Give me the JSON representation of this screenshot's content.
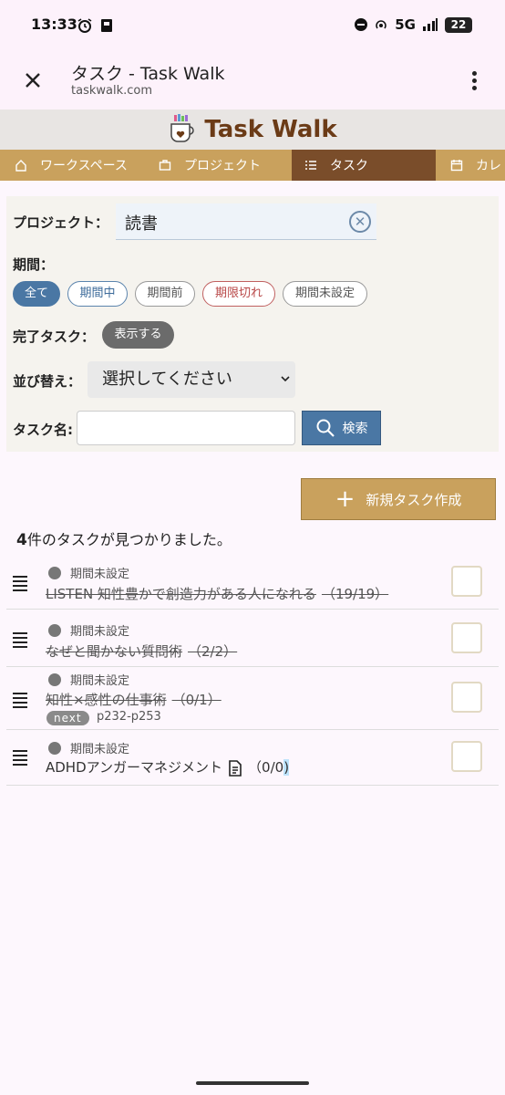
{
  "status": {
    "time": "13:33",
    "network": "5G",
    "battery": "22"
  },
  "browser": {
    "title": "タスク - Task Walk",
    "url": "taskwalk.com"
  },
  "site": {
    "brand": "Task Walk"
  },
  "nav": {
    "items": [
      {
        "label": "ワークスペース",
        "icon": "home-icon"
      },
      {
        "label": "プロジェクト",
        "icon": "briefcase-icon"
      },
      {
        "label": "タスク",
        "icon": "list-icon"
      },
      {
        "label": "カレ",
        "icon": "calendar-icon"
      }
    ]
  },
  "filters": {
    "project_label": "プロジェクト：",
    "project_value": "読書",
    "period_label": "期間：",
    "period_chips": [
      "全て",
      "期間中",
      "期間前",
      "期限切れ",
      "期間未設定"
    ],
    "completed_label": "完了タスク：",
    "completed_button": "表示する",
    "sort_label": "並び替え：",
    "sort_value": "選択してください",
    "taskname_label": "タスク名:",
    "taskname_value": "",
    "search_button": "検索"
  },
  "new_task_button": "新規タスク作成",
  "result": {
    "count": "4",
    "suffix": "件のタスクが見つかりました。"
  },
  "tasks": [
    {
      "period": "期間未設定",
      "name": "LISTEN 知性豊かで創造力がある人になれる",
      "count": "（19/19）",
      "done": true
    },
    {
      "period": "期間未設定",
      "name": "なぜと聞かない質問術",
      "count": "（2/2）",
      "done": true
    },
    {
      "period": "期間未設定",
      "name": "知性×感性の仕事術",
      "count": "（0/1）",
      "done": true,
      "badge": "next",
      "pages": "p232-p253"
    },
    {
      "period": "期間未設定",
      "name": "ADHDアンガーマネジメント",
      "count": "（0/0",
      "count_end": ")",
      "done": false
    }
  ],
  "colors": {
    "nav_bg": "#c9a15d",
    "nav_active": "#7a4d2a",
    "brand": "#6b3b17",
    "primary": "#4a77a4"
  }
}
